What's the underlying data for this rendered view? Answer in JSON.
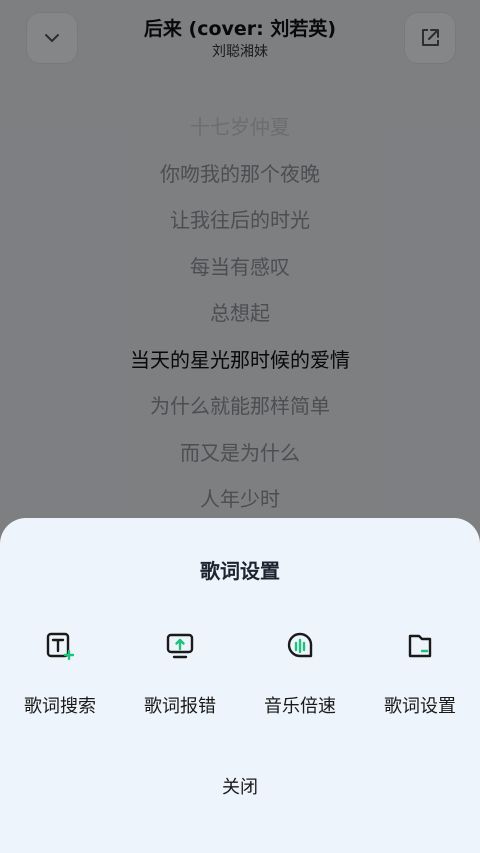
{
  "player": {
    "title": "后来 (cover: 刘若英)",
    "artist": "刘聪湘妹",
    "lyrics": [
      "十七岁仲夏",
      "你吻我的那个夜晚",
      "让我往后的时光",
      "每当有感叹",
      "总想起",
      "当天的星光那时候的爱情",
      "为什么就能那样简单",
      "而又是为什么",
      "人年少时"
    ],
    "current_index": 5,
    "icons": {
      "collapse": "chevron-down-icon",
      "share": "share-icon"
    }
  },
  "sheet": {
    "title": "歌词设置",
    "options": [
      {
        "label": "歌词搜索",
        "icon": "lyrics-search-icon"
      },
      {
        "label": "歌词报错",
        "icon": "lyrics-report-icon"
      },
      {
        "label": "音乐倍速",
        "icon": "playback-speed-icon"
      },
      {
        "label": "歌词设置",
        "icon": "lyrics-settings-icon"
      }
    ],
    "close_label": "关闭",
    "accent": "#1ec27a"
  }
}
